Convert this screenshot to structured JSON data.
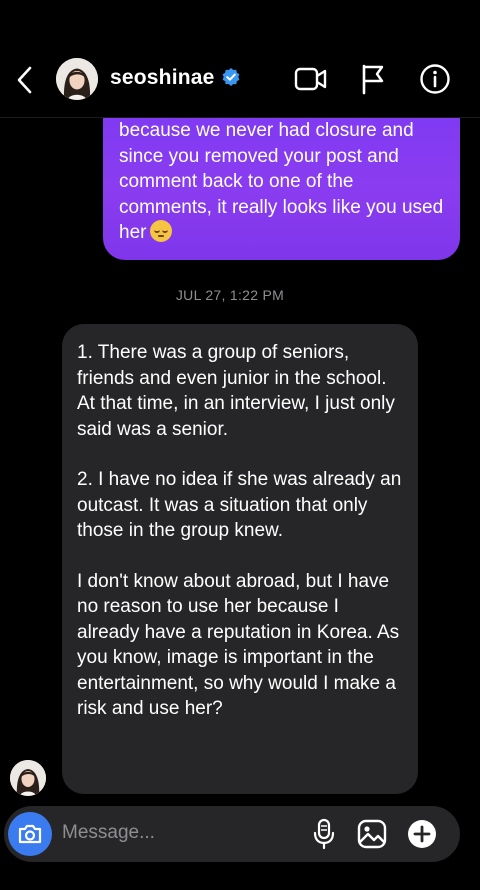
{
  "header": {
    "username": "seoshinae",
    "icons": [
      "back-chevron-icon",
      "video-call-icon",
      "flag-icon",
      "info-icon"
    ]
  },
  "thread": {
    "outgoing_message": {
      "text": "because we never had closure and since you removed your post and comment back to one of the comments, it really looks like you used her",
      "emoji": "pensive-face"
    },
    "timestamp": "JUL 27, 1:22 PM",
    "incoming_message": {
      "paragraphs": [
        "1. There was a group of seniors, friends and even junior in the school. At that time, in an interview, I just only said was a senior.",
        "2. I have no idea if she was already an outcast. It was a situation that only those in the group knew.",
        "I don't know about abroad, but I have no reason to use her because I already have a reputation in Korea. As you know, image is important in the entertainment, so why would I make a risk and use her?"
      ]
    }
  },
  "composer": {
    "placeholder": "Message...",
    "icons": [
      "camera-icon",
      "microphone-icon",
      "gallery-icon",
      "add-icon"
    ]
  },
  "colors": {
    "background": "#000000",
    "outgoing_bubble": "#7d3af2",
    "incoming_bubble": "#262628",
    "camera_button": "#3a7bf0",
    "verified_badge": "#3897f0"
  }
}
